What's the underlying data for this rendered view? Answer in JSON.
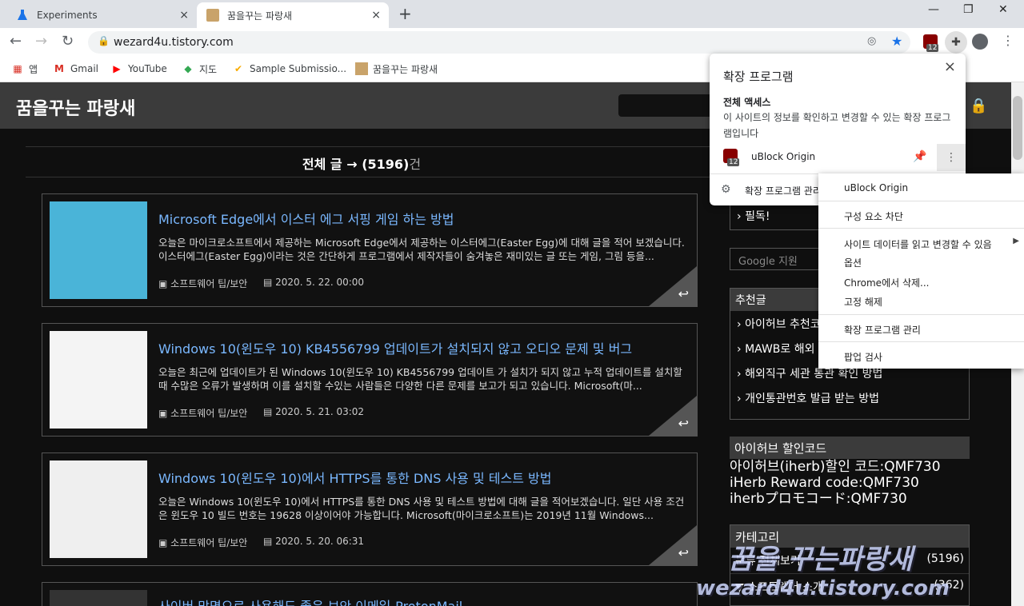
{
  "tabs": [
    {
      "label": "Experiments",
      "close": "×"
    },
    {
      "label": "꿈을꾸는 파랑새",
      "close": "×"
    }
  ],
  "new_tab": "+",
  "window": {
    "minimize": "—",
    "maximize": "❐",
    "close": "✕"
  },
  "address": {
    "url": "wezard4u.tistory.com"
  },
  "toolbar_badge": "12",
  "bookmarks": [
    {
      "label": "앱",
      "icon": "apps-icon"
    },
    {
      "label": "Gmail",
      "icon": "gmail-icon"
    },
    {
      "label": "YouTube",
      "icon": "youtube-icon"
    },
    {
      "label": "지도",
      "icon": "maps-icon"
    },
    {
      "label": "Sample Submissio...",
      "icon": "check-icon"
    },
    {
      "label": "꿈을꾸는 파랑새",
      "icon": "site-icon"
    }
  ],
  "site": {
    "title": "꿈을꾸는 파랑새"
  },
  "post_count": {
    "prefix": "전체 글 → ",
    "count": "(5196)",
    "suffix": "건"
  },
  "posts": [
    {
      "title": "Microsoft Edge에서 이스터 에그 서핑 게임 하는 방법",
      "desc": "오늘은 마이크로소프트에서 제공하는 Microsoft Edge에서 제공하는 이스터에그(Easter Egg)에 대해 글을 적어 보겠습니다. 이스터에그(Easter Egg)이라는 것은 간단하게 프로그램에서 제작자들이 숨겨놓은 재미있는 글 또는 게임, 그림 등을...",
      "category": "소프트웨어 팁/보안",
      "date": "2020. 5. 22. 00:00"
    },
    {
      "title": "Windows 10(윈도우 10) KB4556799 업데이트가 설치되지 않고 오디오 문제 및 버그",
      "desc": "오늘은 최근에 업데이트가 된 Windows 10(윈도우 10) KB4556799 업데이트 가 설치가 되지 않고 누적 업데이트를 설치할 때 수많은 오류가 발생하며 이를 설치할 수있는 사람들은 다양한 다른 문제를 보고가 되고 있습니다. Microsoft(마...",
      "category": "소프트웨어 팁/보안",
      "date": "2020. 5. 21. 03:02"
    },
    {
      "title": "Windows 10(윈도우 10)에서 HTTPS를 통한 DNS 사용 및 테스트 방법",
      "desc": "오늘은 Windows 10(윈도우 10)에서 HTTPS를 통한 DNS 사용 및 테스트 방법에 대해 글을 적어보겠습니다. 일단 사용 조건은 윈도우 10 빌드 번호는 19628 이상이어야 가능합니다. Microsoft(마이크로소프트)는 2019년 11월 Windows...",
      "category": "소프트웨어 팁/보안",
      "date": "2020. 5. 20. 06:31"
    },
    {
      "title": "사이버 망명으로 사용해도 좋은 보안 이메일-ProtonMail",
      "desc": "",
      "category": "",
      "date": ""
    }
  ],
  "sidebar": {
    "must_read": "필독!",
    "google_placeholder": "Google 지원",
    "recommended_header": "추천글",
    "recommended": [
      "아이허브 추천코",
      "MAWB로 해외",
      "해외직구 세관 통관 확인 방법",
      "개인통관번호 발급 받는 방법"
    ],
    "iherb_header": "아이허브 할인코드",
    "iherb_lines": [
      "아이허브(iherb)할인 코드:QMF730",
      "iHerb Reward code:QMF730",
      "iherbプロモコード:QMF730"
    ],
    "category_header": "카테고리",
    "categories": [
      {
        "label": "분류 전체보기",
        "count": "(5196)"
      },
      {
        "label": "소프트웨어 소개",
        "count": "(362)"
      }
    ]
  },
  "extensions_panel": {
    "title": "확장 프로그램",
    "section": "전체 액세스",
    "desc": "이 사이트의 정보를 확인하고 변경할 수 있는 확장 프로그램입니다",
    "ext_name": "uBlock Origin",
    "ext_badge": "12",
    "manage": "확장 프로그램 관리",
    "close": "×"
  },
  "context_menu": {
    "items": [
      "uBlock Origin",
      "구성 요소 차단",
      "사이트 데이터를 읽고 변경할 수 있음",
      "옵션",
      "Chrome에서 삭제...",
      "고정 해제",
      "확장 프로그램 관리",
      "팝업 검사"
    ]
  },
  "watermark": {
    "line1": "꿈을 꾸는파랑새",
    "line2": "wezard4u.tistory.com"
  }
}
